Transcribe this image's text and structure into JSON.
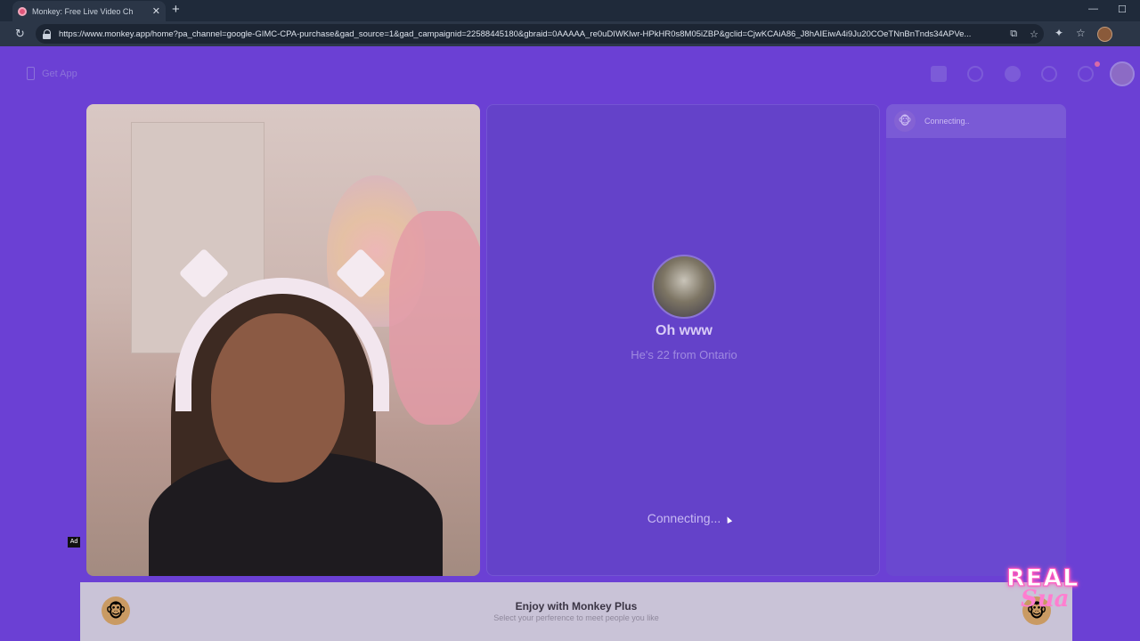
{
  "browser": {
    "tab_title": "Monkey: Free Live Video Ch",
    "url": "https://www.monkey.app/home?pa_channel=google-GIMC-CPA-purchase&gad_source=1&gad_campaignid=22588445180&gbraid=0AAAAA_re0uDIWKlwr-HPkHR0s8M05iZBP&gclid=CjwKCAiA86_J8hAIEiwA4i9Ju20COeTNnBnTnds34APVe..."
  },
  "nav": {
    "get_app_label": "Get App"
  },
  "sidebar": {
    "status_label": "Connecting.."
  },
  "match": {
    "name": "Oh www",
    "subtitle": "He's 22 from Ontario",
    "status": "Connecting..."
  },
  "ad": {
    "badge": "Ad",
    "title": "Enjoy with Monkey Plus",
    "subtitle": "Select your perference to meet people you like"
  },
  "watermark": {
    "line1": "REAL",
    "line2": "Sua"
  },
  "colors": {
    "page_bg": "#6b40d4",
    "accent_pink": "#ff5bc0"
  }
}
